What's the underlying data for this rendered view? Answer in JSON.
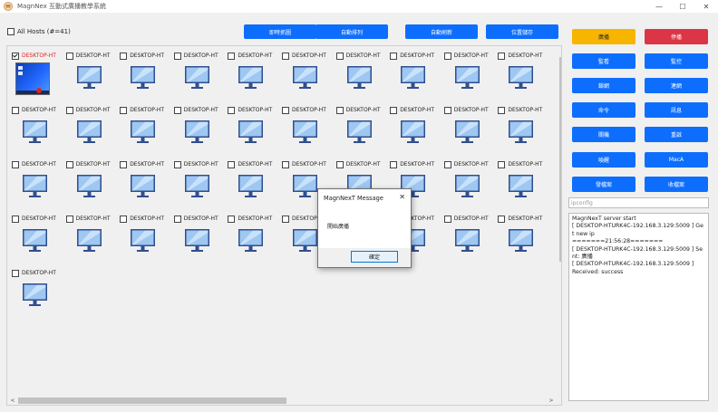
{
  "window": {
    "title": "MagnNex 互動式廣播教學系統",
    "minimize": "—",
    "maximize": "☐",
    "close": "✕"
  },
  "all_hosts": {
    "label": "All Hosts (#=41)",
    "checked": false
  },
  "toolbar": [
    {
      "name": "immediate-fetch-button",
      "label": "即時抓圖"
    },
    {
      "name": "auto-arrange-button",
      "label": "自動排列"
    },
    {
      "name": "auto-refresh-button",
      "label": "自動刷新"
    },
    {
      "name": "save-position-button",
      "label": "位置儲存"
    }
  ],
  "hosts": {
    "name": "DESKTOP-HT",
    "first_checked": true,
    "count": 41
  },
  "right_buttons": [
    {
      "name": "broadcast-button",
      "label": "廣播",
      "color": "#f7b500"
    },
    {
      "name": "stop-broadcast-button",
      "label": "停播",
      "color": "#dc3545"
    },
    {
      "name": "monitor-button",
      "label": "監看",
      "color": "#0d6efd"
    },
    {
      "name": "control-button",
      "label": "監控",
      "color": "#0d6efd"
    },
    {
      "name": "lock-network-button",
      "label": "鎖網",
      "color": "#0d6efd"
    },
    {
      "name": "unlock-network-button",
      "label": "連網",
      "color": "#0d6efd"
    },
    {
      "name": "command-button",
      "label": "命令",
      "color": "#0d6efd"
    },
    {
      "name": "message-button",
      "label": "訊息",
      "color": "#0d6efd"
    },
    {
      "name": "shutdown-button",
      "label": "關機",
      "color": "#0d6efd"
    },
    {
      "name": "restart-button",
      "label": "重啟",
      "color": "#0d6efd"
    },
    {
      "name": "wake-button",
      "label": "喚醒",
      "color": "#0d6efd"
    },
    {
      "name": "mac-address-button",
      "label": "MacA",
      "color": "#0d6efd"
    },
    {
      "name": "send-file-button",
      "label": "發檔案",
      "color": "#0d6efd"
    },
    {
      "name": "collect-file-button",
      "label": "收檔案",
      "color": "#0d6efd"
    }
  ],
  "command_input": {
    "value": "",
    "placeholder": "ipconfig"
  },
  "log": {
    "text": "MagnNexT server start\n[ DESKTOP-HTURK4C-192.168.3.129:5009 ] Get new ip\n=======21:56:28=======\n[ DESKTOP-HTURK4C-192.168.3.129:5009 ] Sent: 廣播\n[ DESKTOP-HTURK4C-192.168.3.129:5009 ]\nReceived: success"
  },
  "dialog": {
    "title": "MagnNexT Message",
    "message": "開始廣播",
    "ok_label": "確定",
    "close": "✕"
  },
  "scroll": {
    "up": "˄",
    "down": "˅",
    "left": "<",
    "right": ">"
  }
}
